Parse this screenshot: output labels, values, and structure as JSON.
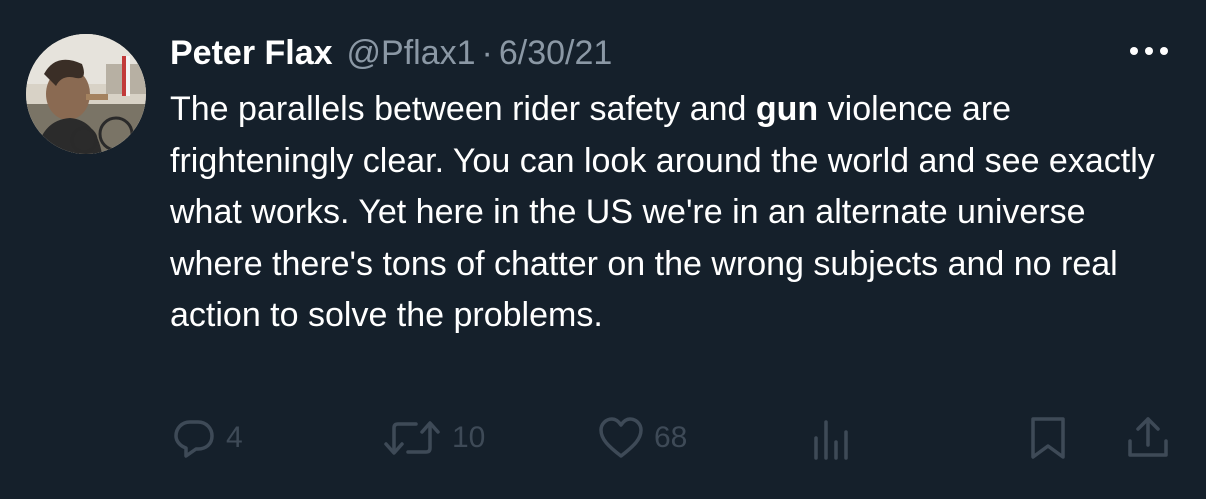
{
  "tweet": {
    "display_name": "Peter Flax",
    "handle": "@Pflax1",
    "separator": "·",
    "date": "6/30/21",
    "text_before": "The parallels between rider safety and  ",
    "text_highlight": "gun",
    "text_after": " violence are frighteningly clear. You can look around the world and see exactly what works. Yet here in the US we're in an alternate universe where there's tons of chatter on the wrong subjects and no real action to solve the problems.",
    "more_icon": "more-horizontal-icon"
  },
  "actions": {
    "reply": {
      "icon": "reply-icon",
      "count": "4"
    },
    "retweet": {
      "icon": "retweet-icon",
      "count": "10"
    },
    "like": {
      "icon": "heart-icon",
      "count": "68"
    },
    "analytics": {
      "icon": "analytics-icon"
    },
    "bookmark": {
      "icon": "bookmark-icon"
    },
    "share": {
      "icon": "share-icon"
    }
  },
  "colors": {
    "background": "#15202b",
    "primary_text": "#ffffff",
    "secondary_text": "#8b98a5",
    "action_icons": "#3e4a57"
  }
}
